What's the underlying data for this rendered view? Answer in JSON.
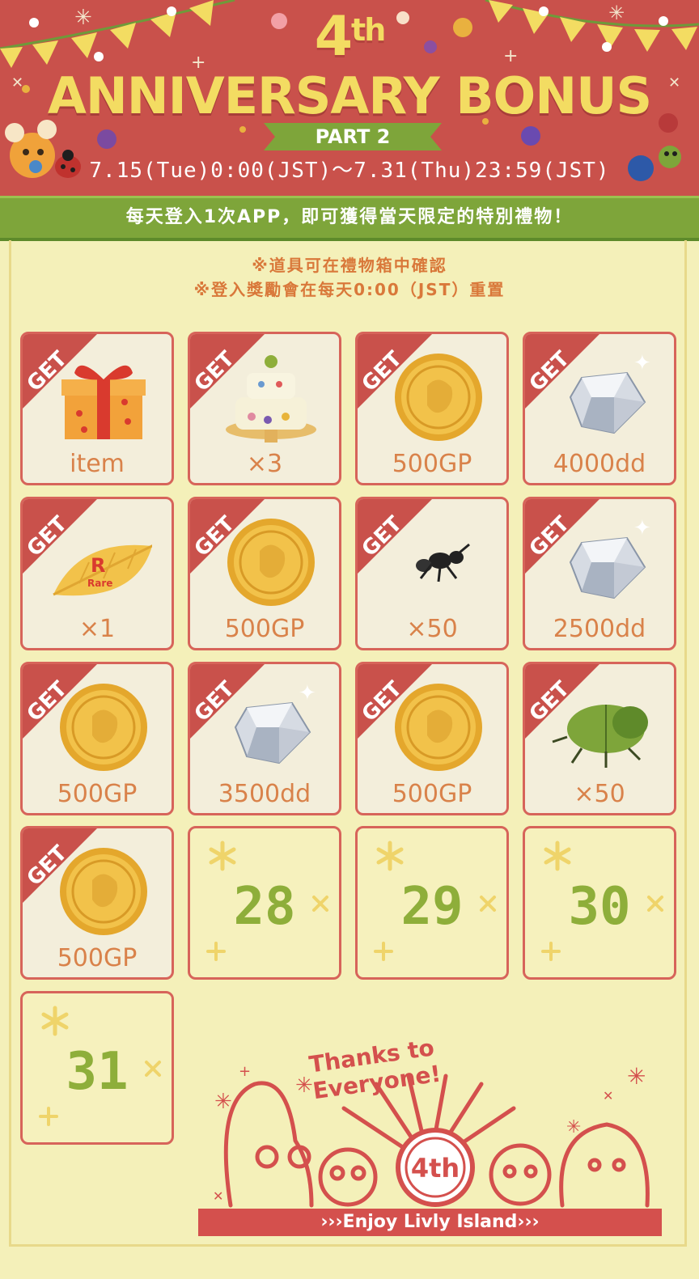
{
  "header": {
    "title_number": "4",
    "title_suffix": "th",
    "title_main": "ANNIVERSARY BONUS",
    "part_label": "PART 2",
    "date_range": "7.15(Tue)0:00(JST)〜7.31(Thu)23:59(JST)"
  },
  "banner": {
    "text": "每天登入1次APP，即可獲得當天限定的特別禮物！"
  },
  "notes": [
    "※道具可在禮物箱中確認",
    "※登入獎勵會在每天0:00（JST）重置"
  ],
  "get_label": "GET",
  "rewards": [
    {
      "label": "item",
      "icon": "gift-box-icon",
      "claimed": true
    },
    {
      "label": "×3",
      "icon": "cake-icon",
      "claimed": true
    },
    {
      "label": "500GP",
      "icon": "gold-coin-icon",
      "claimed": true
    },
    {
      "label": "4000dd",
      "icon": "diamond-icon",
      "claimed": true
    },
    {
      "label": "×1",
      "icon": "rare-leaf-icon",
      "claimed": true
    },
    {
      "label": "500GP",
      "icon": "gold-coin-icon",
      "claimed": true
    },
    {
      "label": "×50",
      "icon": "ant-icon",
      "claimed": true
    },
    {
      "label": "2500dd",
      "icon": "diamond-icon",
      "claimed": true
    },
    {
      "label": "500GP",
      "icon": "gold-coin-icon",
      "claimed": true
    },
    {
      "label": "3500dd",
      "icon": "diamond-icon",
      "claimed": true
    },
    {
      "label": "500GP",
      "icon": "gold-coin-icon",
      "claimed": true
    },
    {
      "label": "×50",
      "icon": "beetle-icon",
      "claimed": true
    },
    {
      "label": "500GP",
      "icon": "gold-coin-icon",
      "claimed": true
    }
  ],
  "rare_leaf": {
    "letter": "R",
    "word": "Rare"
  },
  "upcoming_days": [
    "28",
    "29",
    "30",
    "31"
  ],
  "footer": {
    "thanks": "Thanks to Everyone!",
    "enjoy": "›››Enjoy Livly Island›››",
    "badge": "4th"
  },
  "colors": {
    "header_red": "#c9514b",
    "title_yellow": "#f3dc62",
    "banner_green": "#7ea53a",
    "page_bg": "#f4f0b9",
    "tile_border": "#d7645a",
    "label_orange": "#d9824a",
    "day_green": "#8eae3a"
  }
}
